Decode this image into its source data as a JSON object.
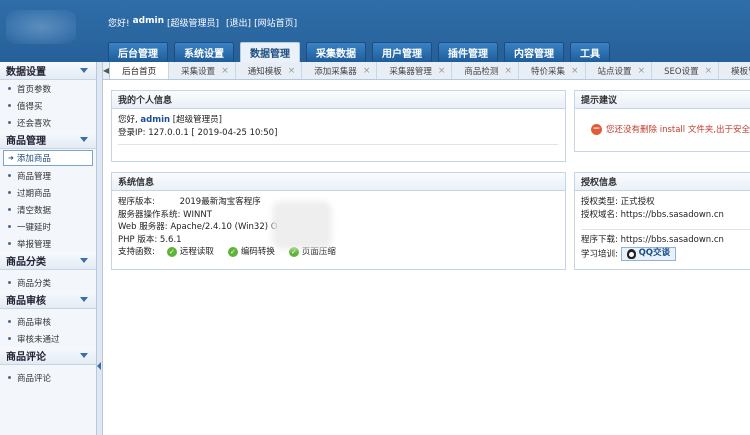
{
  "header": {
    "greeting": "您好!",
    "username": "admin",
    "role": "[超级管理员]",
    "logout": "[退出]",
    "site_home": "[网站首页]",
    "nav": [
      "后台管理",
      "系统设置",
      "数据管理",
      "采集数据",
      "用户管理",
      "插件管理",
      "内容管理",
      "工具"
    ],
    "active_nav_index": 2
  },
  "sidebar": {
    "sections": [
      {
        "title": "数据设置",
        "items": [
          "首页参数",
          "值得买",
          "还会喜欢"
        ]
      },
      {
        "title": "商品管理",
        "items": [
          "添加商品",
          "商品管理",
          "过期商品",
          "清空数据",
          "一键延时",
          "举报管理"
        ],
        "active_item_index": 0
      },
      {
        "title": "商品分类",
        "items": [
          "商品分类"
        ]
      },
      {
        "title": "商品审核",
        "items": [
          "商品审核",
          "审核未通过"
        ]
      },
      {
        "title": "商品评论",
        "items": [
          "商品评论"
        ]
      }
    ]
  },
  "tabs": {
    "prev": "◀",
    "items": [
      "后台首页",
      "采集设置",
      "通知模板",
      "添加采集器",
      "采集器管理",
      "商品检测",
      "特价采集",
      "站点设置",
      "SEO设置",
      "模板管理"
    ],
    "active_index": 0,
    "close_glyph": "×"
  },
  "personal": {
    "title": "我的个人信息",
    "hello": "您好,",
    "username": "admin",
    "role": "[超级管理员]",
    "login_ip_label": "登录IP:",
    "login_ip": "127.0.0.1",
    "login_time": "[ 2019-04-25 10:50]"
  },
  "system": {
    "title": "系统信息",
    "program_version_label": "程序版本:",
    "program_version": "2019最新淘宝客程序",
    "os_label": "服务器操作系统:",
    "os": "WINNT",
    "web_server_label": "Web 服务器:",
    "web_server": "Apache/2.4.10 (Win32) O",
    "php_label": "PHP 版本:",
    "php": "5.6.1",
    "funcs_label": "支持函数:",
    "funcs": [
      "远程读取",
      "编码转换",
      "页面压缩"
    ]
  },
  "tips": {
    "title": "提示建议",
    "warning": "您还没有删除 install 文件夹,出于安全"
  },
  "license": {
    "title": "授权信息",
    "type_label": "授权类型:",
    "type": "正式授权",
    "domain_label": "授权域名:",
    "domain": "https://bbs.sasadown.cn",
    "download_label": "程序下载:",
    "download": "https://bbs.sasadown.cn",
    "training_label": "学习培训:",
    "qq_button": "QQ交谈"
  },
  "colors": {
    "header_bg": "#2a66a0",
    "accent_link": "#1a4e9a",
    "warning_red": "#c23a2a",
    "check_green": "#5fb336"
  }
}
